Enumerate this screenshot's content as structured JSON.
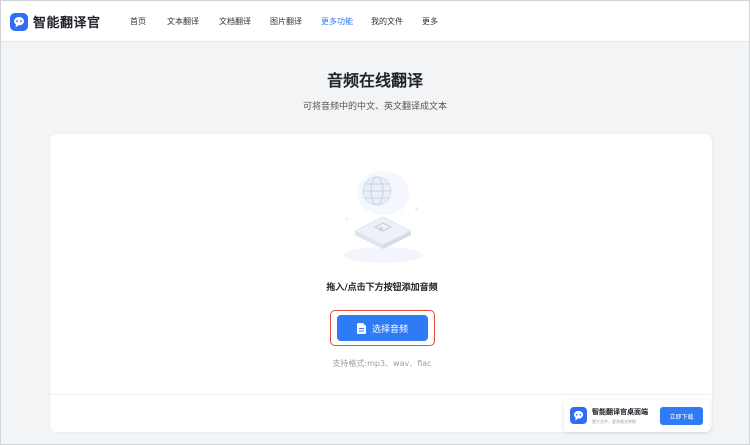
{
  "app": {
    "name": "智能翻译官"
  },
  "nav": {
    "items": [
      {
        "label": "首页"
      },
      {
        "label": "文本翻译"
      },
      {
        "label": "文档翻译"
      },
      {
        "label": "图片翻译"
      },
      {
        "label": "更多功能",
        "active": true
      },
      {
        "label": "我的文件"
      },
      {
        "label": "更多"
      }
    ]
  },
  "page": {
    "title": "音频在线翻译",
    "subtitle": "可将音频中的中文、英文翻译成文本"
  },
  "upload": {
    "drop_text": "拖入/点击下方按钮添加音频",
    "button_label": "选择音频",
    "formats": "支持格式:mp3、wav、flac"
  },
  "promo": {
    "title": "智能翻译官桌面端",
    "subtitle": "更大文件、更多格式转换",
    "button_label": "立即下载"
  },
  "colors": {
    "accent": "#2f7bf6",
    "highlight_border": "#e24a3b",
    "background": "#f3f4f6"
  },
  "icons": [
    "app-logo-icon",
    "globe-chat-icon",
    "audio-file-icon",
    "file-icon"
  ]
}
